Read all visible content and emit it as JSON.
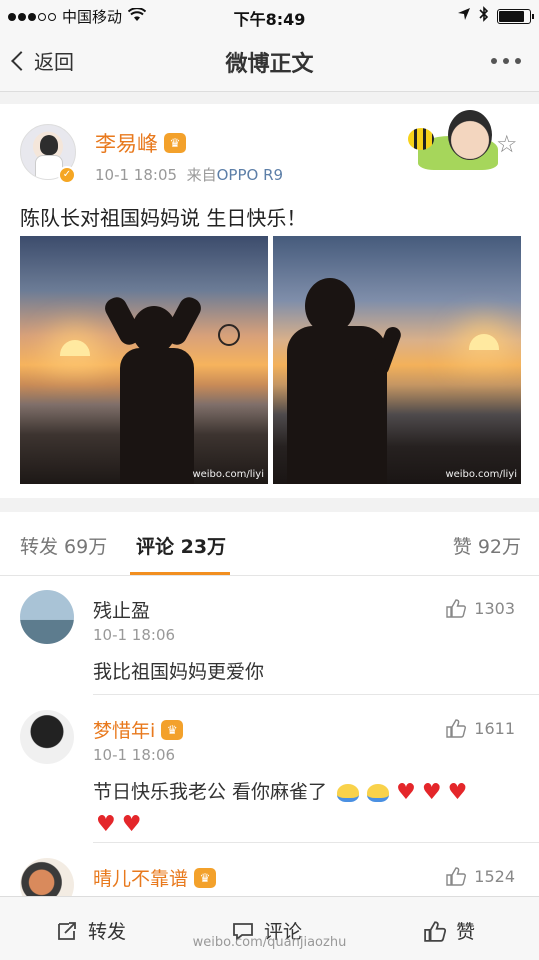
{
  "status_bar": {
    "carrier": "中国移动",
    "time": "下午8:49",
    "battery_level": 0.85
  },
  "nav": {
    "back_label": "返回",
    "title": "微博正文"
  },
  "post": {
    "author": "李易峰",
    "time": "10-1 18:05",
    "source_prefix": "来自",
    "source": "OPPO R9",
    "text": "陈队长对祖国妈妈说 生日快乐！",
    "photos": [
      {
        "watermark": "weibo.com/liyi"
      },
      {
        "watermark": "weibo.com/liyi"
      }
    ]
  },
  "tabs": {
    "repost": "转发 69万",
    "comments": "评论 23万",
    "likes": "赞 92万"
  },
  "comments": [
    {
      "name": "残止盈",
      "time": "10-1 18:06",
      "text": "我比祖国妈妈更爱你",
      "likes": "1303"
    },
    {
      "name": "梦惜年i",
      "time": "10-1 18:06",
      "text": "节日快乐我老公 看你麻雀了",
      "likes": "1611"
    },
    {
      "name": "晴儿不靠谱",
      "time": "",
      "text": "",
      "likes": "1524"
    }
  ],
  "toolbar": {
    "repost": "转发",
    "comment": "评论",
    "like": "赞",
    "watermark": "weibo.com/quanjiaozhu"
  },
  "colors": {
    "accent": "#f28f20",
    "vip_name": "#e8791d",
    "source_link": "#5d7fa8"
  },
  "icons": [
    "back-chevron-icon",
    "more-icon",
    "star-icon",
    "thumbs-up-icon",
    "repost-icon",
    "comment-icon",
    "verified-icon",
    "crown-icon"
  ]
}
